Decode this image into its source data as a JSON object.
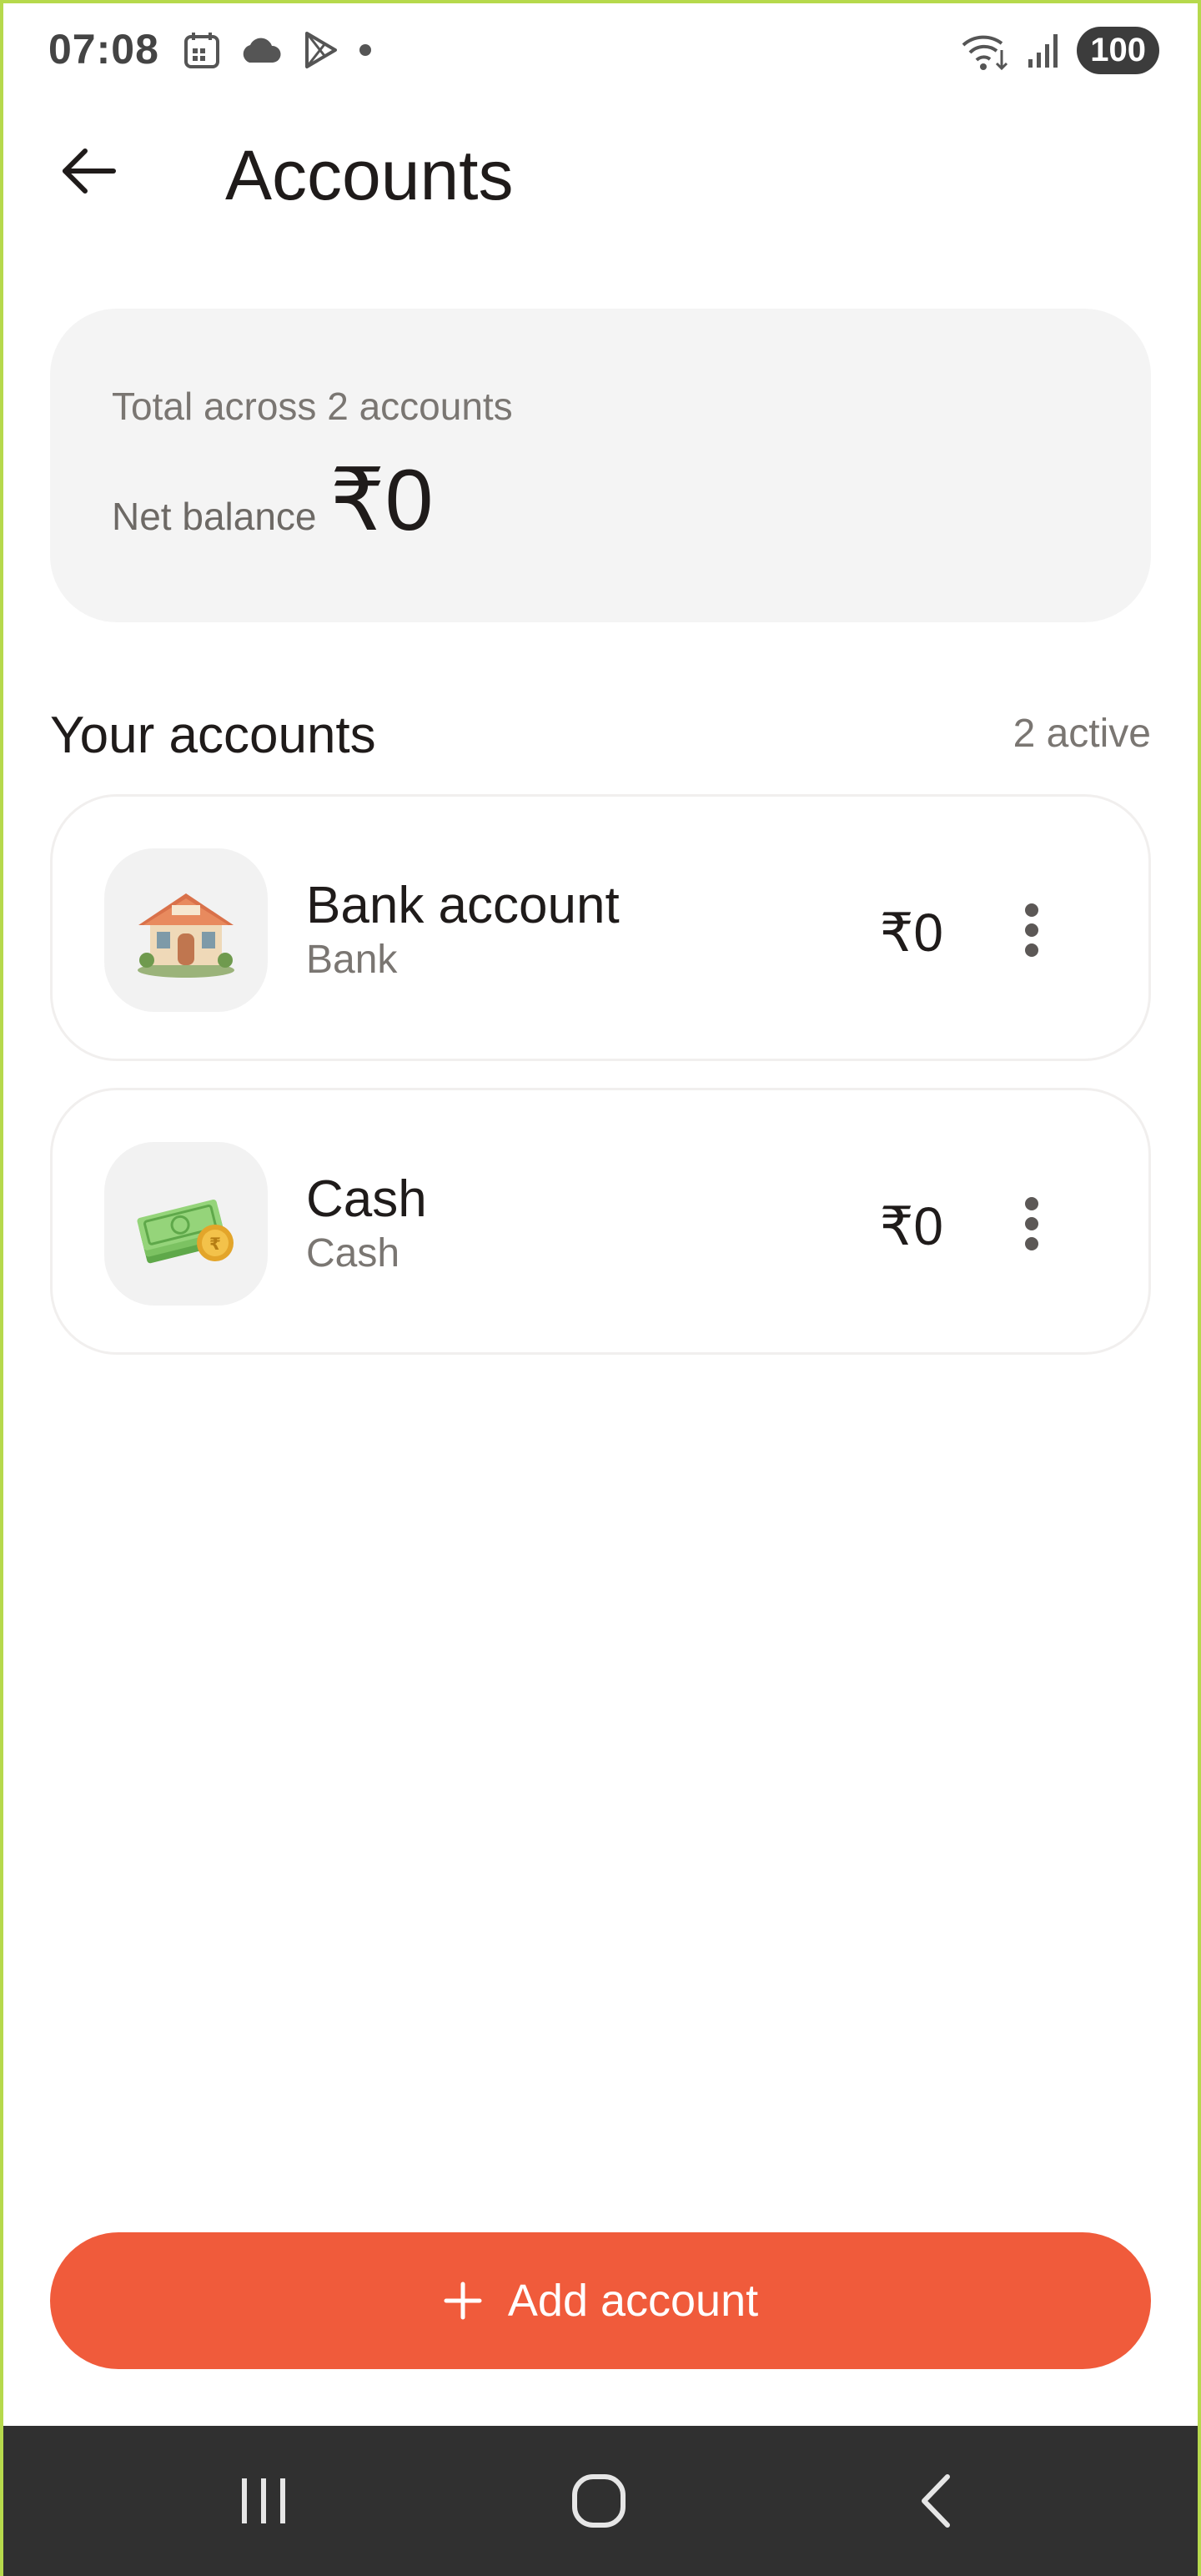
{
  "status_bar": {
    "time": "07:08",
    "battery": "100",
    "left_icons": [
      "calendar-icon",
      "cloud-icon",
      "play-store-icon",
      "dot-icon"
    ],
    "right_icons": [
      "wifi-icon",
      "signal-icon",
      "battery-icon"
    ]
  },
  "header": {
    "title": "Accounts",
    "back_icon": "arrow-left-icon"
  },
  "summary": {
    "subtitle": "Total across 2 accounts",
    "net_label": "Net balance",
    "net_value": "₹0"
  },
  "section": {
    "title": "Your accounts",
    "count": "2 active"
  },
  "accounts": [
    {
      "name": "Bank account",
      "type": "Bank",
      "balance": "₹0",
      "icon": "bank-building-icon"
    },
    {
      "name": "Cash",
      "type": "Cash",
      "balance": "₹0",
      "icon": "cash-stack-icon"
    }
  ],
  "add_button": {
    "label": "Add account",
    "icon": "plus-icon",
    "color": "#F05B3B"
  },
  "nav": {
    "icons": [
      "recent-apps-icon",
      "home-icon",
      "back-icon"
    ]
  }
}
